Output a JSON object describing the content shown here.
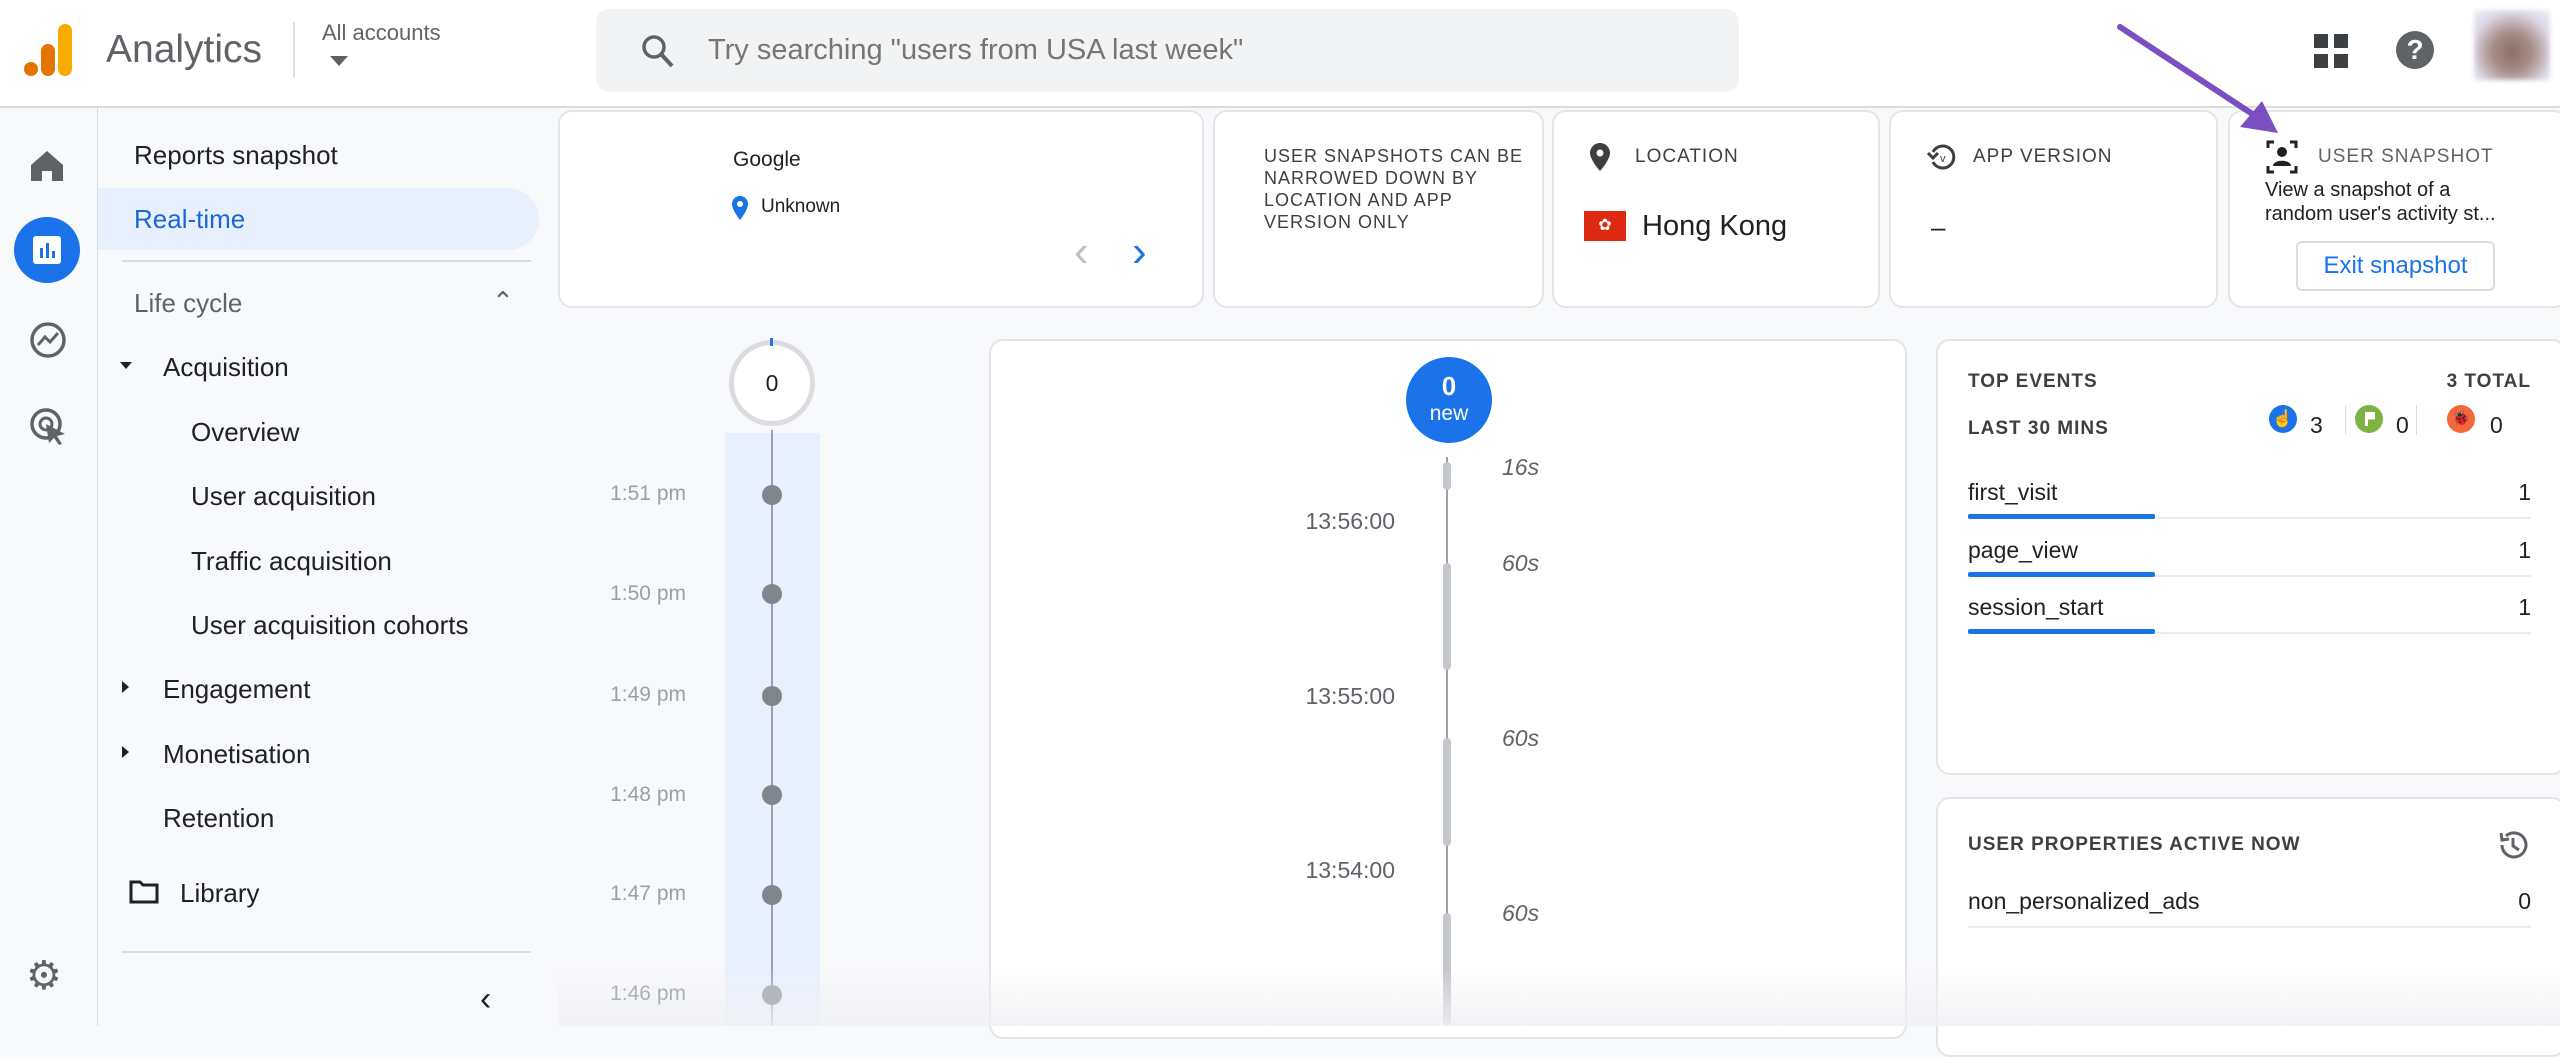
{
  "header": {
    "app_title": "Analytics",
    "account_label": "All accounts",
    "search_placeholder": "Try searching \"users from USA last week\"",
    "icons": [
      "apps-grid-icon",
      "help-icon",
      "avatar"
    ]
  },
  "nav": {
    "reports_snapshot": "Reports snapshot",
    "realtime": "Real-time",
    "section": "Life cycle",
    "acquisition": "Acquisition",
    "acq_items": [
      "Overview",
      "User acquisition",
      "Traffic acquisition",
      "User acquisition cohorts"
    ],
    "engagement": "Engagement",
    "monetisation": "Monetisation",
    "retention": "Retention",
    "library": "Library"
  },
  "device_card": {
    "source": "Google",
    "location": "Unknown"
  },
  "info_card": {
    "text": "USER SNAPSHOTS CAN BE NARROWED DOWN BY LOCATION AND APP VERSION ONLY"
  },
  "location_card": {
    "label": "LOCATION",
    "value": "Hong Kong"
  },
  "app_version_card": {
    "label": "APP VERSION",
    "value": "–"
  },
  "snapshot_card": {
    "label": "USER SNAPSHOT",
    "description_line1": "View a snapshot of a",
    "description_line2": "random user's activity st...",
    "exit_button": "Exit snapshot"
  },
  "minute_timeline": {
    "count": "0",
    "times": [
      "1:51 pm",
      "1:50 pm",
      "1:49 pm",
      "1:48 pm",
      "1:47 pm",
      "1:46 pm"
    ]
  },
  "stream": {
    "new_count": "0",
    "new_label": "new",
    "timestamps": [
      "13:56:00",
      "13:55:00",
      "13:54:00"
    ],
    "durations": [
      "16s",
      "60s",
      "60s",
      "60s"
    ]
  },
  "top_events": {
    "title": "TOP EVENTS",
    "total": "3 TOTAL",
    "period": "LAST 30 MINS",
    "counters": [
      {
        "icon": "touch-icon",
        "value": "3",
        "color": "#1a73e8"
      },
      {
        "icon": "flag-icon",
        "value": "0",
        "color": "#7cb342"
      },
      {
        "icon": "bug-icon",
        "value": "0",
        "color": "#f4683c"
      }
    ],
    "events": [
      {
        "name": "first_visit",
        "value": "1"
      },
      {
        "name": "page_view",
        "value": "1"
      },
      {
        "name": "session_start",
        "value": "1"
      }
    ]
  },
  "user_properties": {
    "title": "USER PROPERTIES ACTIVE NOW",
    "items": [
      {
        "name": "non_personalized_ads",
        "value": "0"
      }
    ]
  },
  "colors": {
    "accent": "#1a73e8",
    "annotation_arrow": "#7b4fc0"
  }
}
